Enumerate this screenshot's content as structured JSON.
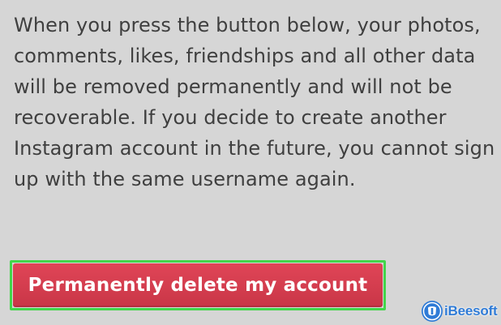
{
  "warning": {
    "lines": [
      "When you press the button below, your photos,",
      "comments, likes, friendships and all other data",
      "will be removed permanently and will not be",
      "recoverable. If you decide to create another",
      "Instagram account in the future, you cannot sign",
      "up with the same username again."
    ]
  },
  "delete_button": {
    "label": "Permanently delete my account",
    "color": "#d63d4f",
    "highlight_color": "#42d64a"
  },
  "watermark": {
    "text": "iBeesoft",
    "icon": "ibeesoft-logo-icon",
    "color": "#2f7bd6"
  }
}
